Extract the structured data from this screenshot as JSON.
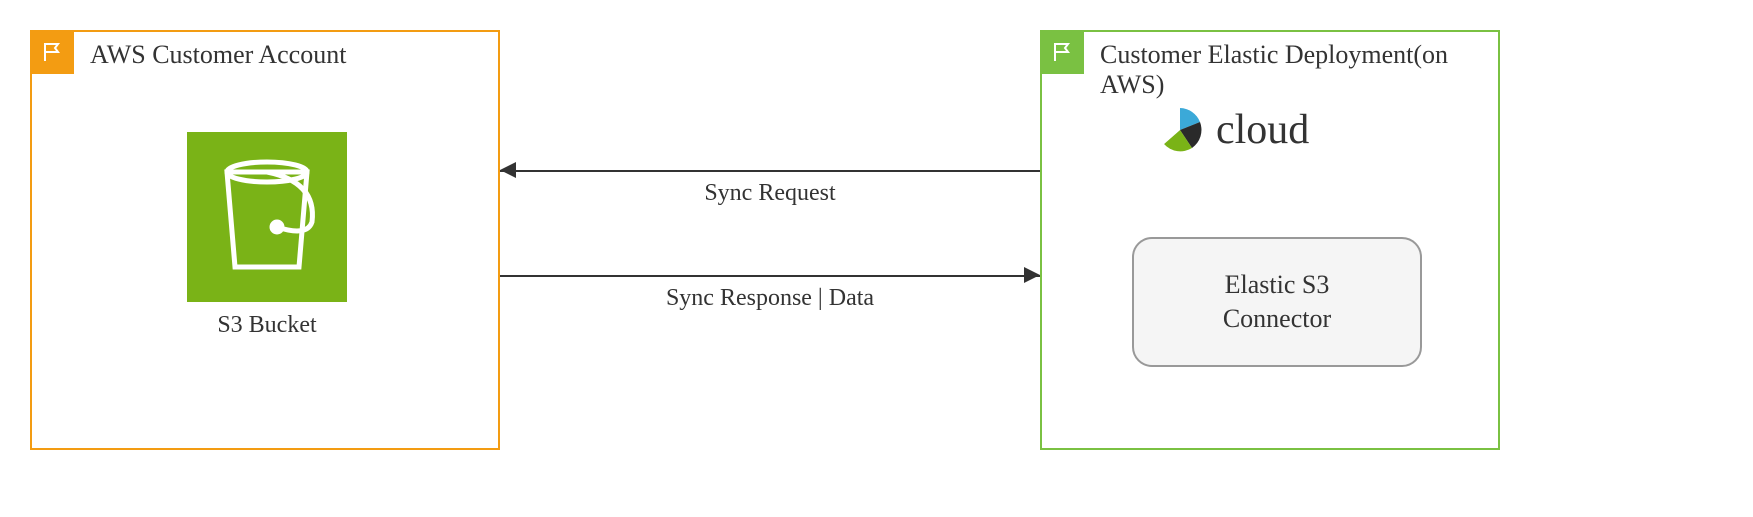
{
  "left_box": {
    "title": "AWS Customer Account",
    "s3_label": "S3 Bucket"
  },
  "right_box": {
    "title": "Customer Elastic Deployment(on AWS)",
    "cloud_label": "cloud",
    "connector_label": "Elastic S3\nConnector"
  },
  "arrows": {
    "request_label": "Sync Request",
    "response_label": "Sync Response | Data"
  },
  "colors": {
    "orange": "#f39c12",
    "green": "#7ac142",
    "s3_green": "#7ab317"
  }
}
